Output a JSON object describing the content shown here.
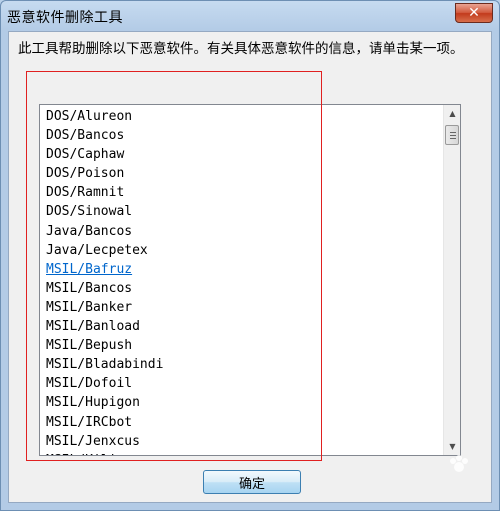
{
  "window": {
    "title": "恶意软件删除工具"
  },
  "description": "此工具帮助删除以下恶意软件。有关具体恶意软件的信息，请单击某一项。",
  "list": {
    "items": [
      {
        "label": "DOS/Alureon"
      },
      {
        "label": "DOS/Bancos"
      },
      {
        "label": "DOS/Caphaw"
      },
      {
        "label": "DOS/Poison"
      },
      {
        "label": "DOS/Ramnit"
      },
      {
        "label": "DOS/Sinowal"
      },
      {
        "label": "Java/Bancos"
      },
      {
        "label": "Java/Lecpetex"
      },
      {
        "label": "MSIL/Bafruz",
        "hovered": true
      },
      {
        "label": "MSIL/Bancos"
      },
      {
        "label": "MSIL/Banker"
      },
      {
        "label": "MSIL/Banload"
      },
      {
        "label": "MSIL/Bepush"
      },
      {
        "label": "MSIL/Bladabindi"
      },
      {
        "label": "MSIL/Dofoil"
      },
      {
        "label": "MSIL/Hupigon"
      },
      {
        "label": "MSIL/IRCbot"
      },
      {
        "label": "MSIL/Jenxcus"
      },
      {
        "label": "MSIL/Kilim"
      }
    ]
  },
  "buttons": {
    "ok": "确定"
  },
  "watermark": {
    "text": "Bai 经验"
  },
  "icons": {
    "close": "close-icon",
    "scroll_up": "arrow-up-icon",
    "scroll_down": "arrow-down-icon"
  },
  "colors": {
    "link": "#0066cc",
    "highlight": "#e02020"
  }
}
